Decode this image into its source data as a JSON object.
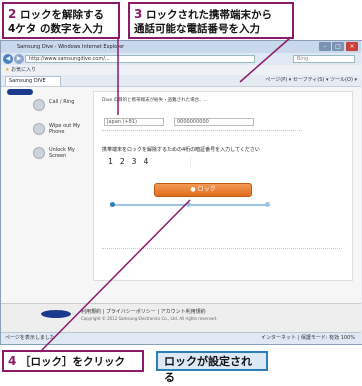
{
  "callouts": {
    "step2": {
      "num": "2",
      "text": "ロックを解除する",
      "text2": "4ケタ の数字を入力"
    },
    "step3": {
      "num": "3",
      "text": "ロックされた携帯端末から",
      "text2": "通話可能な電話番号を入力"
    },
    "step4": {
      "num": "4",
      "text": "［ロック］をクリック"
    },
    "result": "ロックが設定される"
  },
  "browser": {
    "title": "Samsung Dive - Windows Internet Explorer",
    "url": "http://www.samsungdive.com/...",
    "search_placeholder": "Bing",
    "favorites": "お気に入り",
    "tab_label": "Samsung DIVE",
    "commands": "ページ(P) ▾  セーフティ(S) ▾  ツール(O) ▾",
    "status_left": "ページを表示しました",
    "status_right": "インターネット | 保護モード: 有効",
    "zoom": "100%"
  },
  "page": {
    "sidebar": [
      {
        "label": "Call / Ring"
      },
      {
        "label": "Wipe out My Phone"
      },
      {
        "label": "Unlock My Screen"
      }
    ],
    "intro": "Dive の目的と携帯端末が紛失・盗難された場合、...",
    "phone_country": "Japan (+81)",
    "phone_number": "0000000000",
    "unlock_title": "携帯端末をロックを解除するための4桁の暗証番号を入力してください",
    "pin_digits": "1234",
    "lock_button": "ロック",
    "footer_links": "利用規約  |  プライバシーポリシー  |  アカウント利用規約",
    "copyright": "Copyright © 2012 Samsung Electronics Co., Ltd. All rights reserved."
  }
}
